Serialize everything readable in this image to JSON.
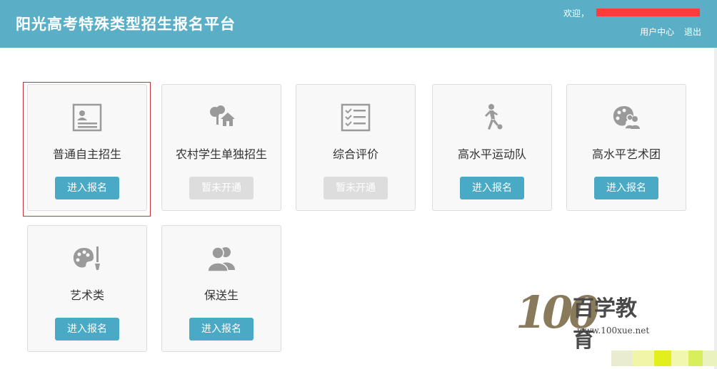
{
  "header": {
    "title": "阳光高考特殊类型招生报名平台",
    "welcome": "欢迎，",
    "user_center": "用户中心",
    "logout": "退出"
  },
  "cards": [
    {
      "name": "普通自主招生",
      "button": "进入报名",
      "enabled": true,
      "icon": "id-card-icon"
    },
    {
      "name": "农村学生单独招生",
      "button": "暂未开通",
      "enabled": false,
      "icon": "rural-house-icon"
    },
    {
      "name": "综合评价",
      "button": "暂未开通",
      "enabled": false,
      "icon": "checklist-icon"
    },
    {
      "name": "高水平运动队",
      "button": "进入报名",
      "enabled": true,
      "icon": "athlete-icon"
    },
    {
      "name": "高水平艺术团",
      "button": "进入报名",
      "enabled": true,
      "icon": "palette-people-icon"
    },
    {
      "name": "艺术类",
      "button": "进入报名",
      "enabled": true,
      "icon": "palette-brush-icon"
    },
    {
      "name": "保送生",
      "button": "进入报名",
      "enabled": true,
      "icon": "users-icon"
    }
  ],
  "watermark": {
    "number": "100",
    "brand": "百学教育",
    "url": "www.100xue.net"
  },
  "colors": {
    "header_bg": "#5aafc6",
    "button_enabled": "#4aa9c4",
    "button_disabled": "#dddddd",
    "selection_border": "#c8323a"
  }
}
